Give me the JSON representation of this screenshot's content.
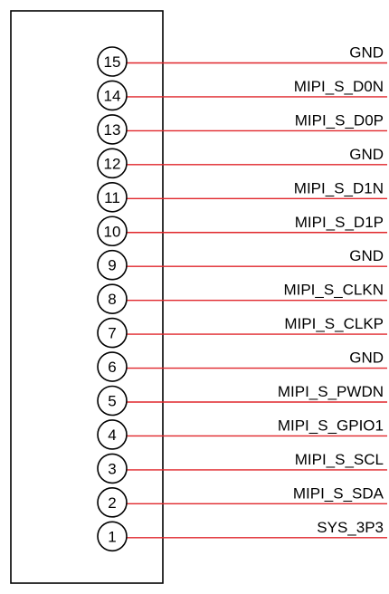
{
  "connector": {
    "pins": [
      {
        "number": "15",
        "net": "GND"
      },
      {
        "number": "14",
        "net": "MIPI_S_D0N"
      },
      {
        "number": "13",
        "net": "MIPI_S_D0P"
      },
      {
        "number": "12",
        "net": "GND"
      },
      {
        "number": "11",
        "net": "MIPI_S_D1N"
      },
      {
        "number": "10",
        "net": "MIPI_S_D1P"
      },
      {
        "number": "9",
        "net": "GND"
      },
      {
        "number": "8",
        "net": "MIPI_S_CLKN"
      },
      {
        "number": "7",
        "net": "MIPI_S_CLKP"
      },
      {
        "number": "6",
        "net": "GND"
      },
      {
        "number": "5",
        "net": "MIPI_S_PWDN"
      },
      {
        "number": "4",
        "net": "MIPI_S_GPIO1"
      },
      {
        "number": "3",
        "net": "MIPI_S_SCL"
      },
      {
        "number": "2",
        "net": "MIPI_S_SDA"
      },
      {
        "number": "1",
        "net": "SYS_3P3"
      }
    ]
  },
  "colors": {
    "wire": "#e0262b",
    "outline": "#000000"
  }
}
